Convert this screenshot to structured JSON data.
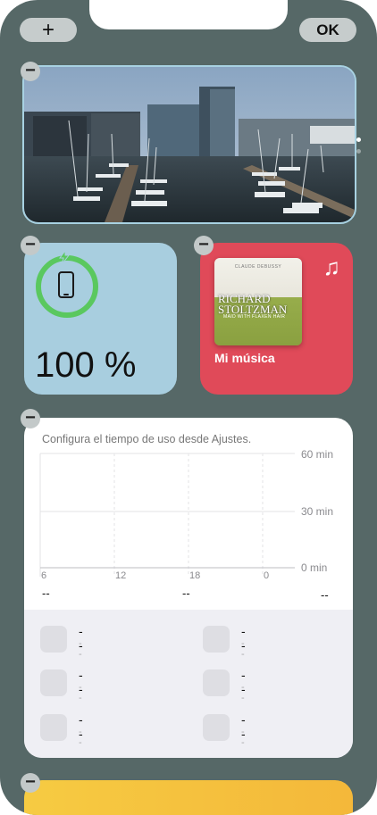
{
  "top_bar": {
    "add_label": "+",
    "done_label": "OK"
  },
  "photo_widget": {
    "page_dots": 2,
    "active_dot": 1
  },
  "battery_widget": {
    "percent_text": "100 %",
    "level": 1.0
  },
  "music_widget": {
    "label": "Mi música",
    "album": {
      "composer": "CLAUDE DEBUSSY",
      "artist_line1": "RICHARD",
      "artist_line2": "STOLTZMAN",
      "title": "MAID WITH FLAXEN HAIR"
    }
  },
  "screen_time_widget": {
    "header": "Configura el tiempo de uso desde Ajustes.",
    "y_ticks": [
      "60 min",
      "30 min",
      "0 min"
    ],
    "x_ticks": [
      "6",
      "12",
      "18",
      "0"
    ],
    "summary_values": [
      "--",
      "--",
      "--"
    ],
    "apps": [
      {
        "name": "--",
        "time": "--"
      },
      {
        "name": "--",
        "time": "--"
      },
      {
        "name": "--",
        "time": "--"
      },
      {
        "name": "--",
        "time": "--"
      },
      {
        "name": "--",
        "time": "--"
      },
      {
        "name": "--",
        "time": "--"
      }
    ]
  },
  "colors": {
    "background": "#566867",
    "battery_bg": "#a8cedf",
    "battery_ring": "#5ac85f",
    "music_bg": "#e04a59",
    "weather_bg": "#f6cb42"
  }
}
